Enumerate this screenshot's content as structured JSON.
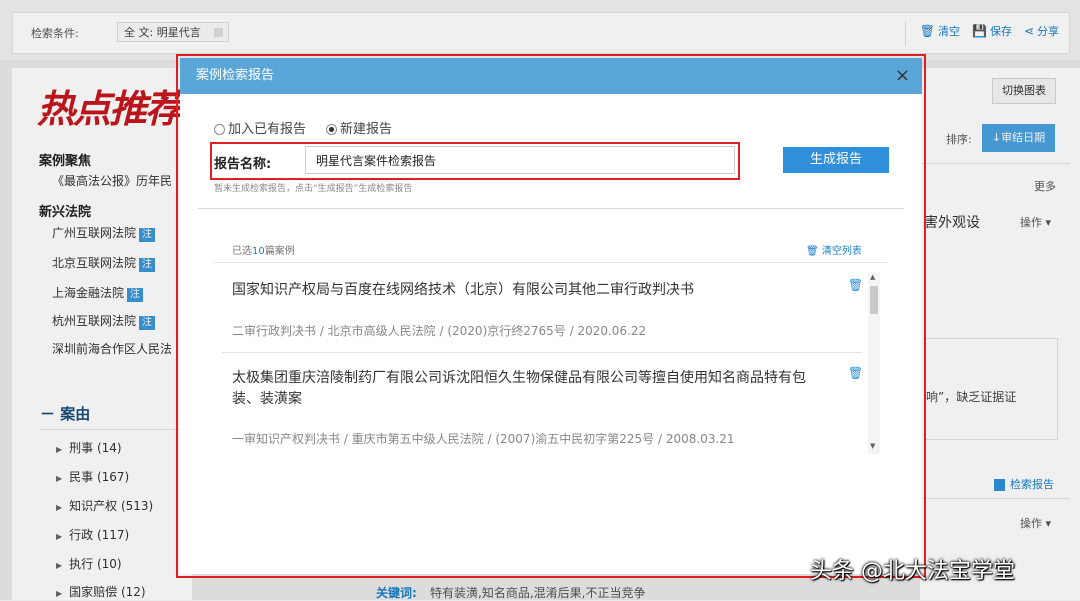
{
  "topbar": {
    "condition_label": "检索条件:",
    "condition_chip": "全 文: 明星代言",
    "actions": [
      {
        "icon": "trash-icon",
        "label": "清空"
      },
      {
        "icon": "save-icon",
        "label": "保存"
      },
      {
        "icon": "share-icon",
        "label": "分享"
      }
    ]
  },
  "left": {
    "logo_text": "热点推荐",
    "focus_title": "案例聚焦",
    "focus_item": "《最高法公报》历年民",
    "court_title": "新兴法院",
    "courts": [
      {
        "label": "广州互联网法院",
        "badge": "注"
      },
      {
        "label": "北京互联网法院",
        "badge": "注"
      },
      {
        "label": "上海金融法院",
        "badge": "注"
      },
      {
        "label": "杭州互联网法院",
        "badge": "注"
      },
      {
        "label": "深圳前海合作区人民法",
        "badge": ""
      }
    ],
    "case_title": "－ 案由",
    "case_categories": [
      "刑事 (14)",
      "民事 (167)",
      "知识产权 (513)",
      "行政 (117)",
      "执行 (10)",
      "国家赔偿 (12)"
    ]
  },
  "right": {
    "toggle_chart": "切换图表",
    "sort_label": "排序:",
    "sort_value": "↓审结日期",
    "more": "更多",
    "snippet1": "害外观设",
    "operate1": "操作 ▾",
    "snippet2": "响”，缺乏证据证",
    "report_link": "检索报告",
    "operate2": "操作 ▾"
  },
  "main": {
    "keyword_label": "关键词:",
    "keyword_value": "特有装潢,知名商品,混淆后果,不正当竞争"
  },
  "modal": {
    "title": "案例检索报告",
    "close": "×",
    "radio_existing": "加入已有报告",
    "radio_new": "新建报告",
    "name_label": "报告名称:",
    "name_value": "明星代言案件检索报告",
    "generate_button": "生成报告",
    "hint": "暂未生成检索报告，点击“生成报告”生成检索报告",
    "selected_prefix": "已选",
    "selected_count": "10",
    "selected_suffix": "篇案例",
    "clear_list": "清空列表",
    "cases": [
      {
        "title": "国家知识产权局与百度在线网络技术（北京）有限公司其他二审行政判决书",
        "meta": "二审行政判决书 / 北京市高级人民法院 / (2020)京行终2765号 / 2020.06.22"
      },
      {
        "title": "太极集团重庆涪陵制药厂有限公司诉沈阳恒久生物保健品有限公司等擅自使用知名商品特有包装、装潢案",
        "meta": "一审知识产权判决书 / 重庆市第五中级人民法院 / (2007)渝五中民初字第225号 / 2008.03.21"
      }
    ]
  },
  "watermark": "头条 @北大法宝学堂"
}
